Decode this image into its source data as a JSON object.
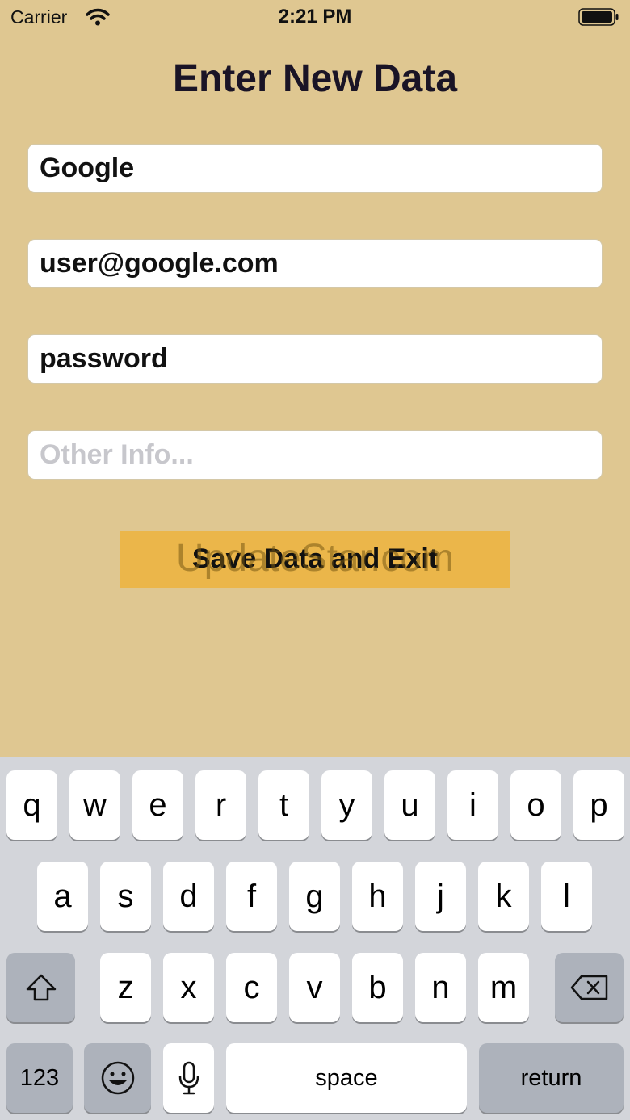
{
  "status_bar": {
    "carrier": "Carrier",
    "time": "2:21 PM",
    "wifi_icon": "wifi-icon",
    "battery_icon": "battery-icon"
  },
  "screen": {
    "title": "Enter New Data"
  },
  "form": {
    "fields": [
      {
        "name": "site",
        "value": "Google",
        "placeholder": ""
      },
      {
        "name": "username",
        "value": "user@google.com",
        "placeholder": ""
      },
      {
        "name": "password",
        "value": "password",
        "placeholder": ""
      },
      {
        "name": "other",
        "value": "",
        "placeholder": "Other Info..."
      }
    ],
    "save_label": "Save Data and Exit"
  },
  "watermark": "UpdateStar.com",
  "keyboard": {
    "row1": [
      "q",
      "w",
      "e",
      "r",
      "t",
      "y",
      "u",
      "i",
      "o",
      "p"
    ],
    "row2": [
      "a",
      "s",
      "d",
      "f",
      "g",
      "h",
      "j",
      "k",
      "l"
    ],
    "row3": [
      "z",
      "x",
      "c",
      "v",
      "b",
      "n",
      "m"
    ],
    "numbers_label": "123",
    "space_label": "space",
    "return_label": "return",
    "icons": {
      "shift": "shift-icon",
      "delete": "backspace-icon",
      "emoji": "emoji-icon",
      "mic": "microphone-icon"
    }
  },
  "colors": {
    "background": "#dfc791",
    "button": "#ebb64a",
    "keyboard": "#d3d5da",
    "title": "#1a1426"
  }
}
